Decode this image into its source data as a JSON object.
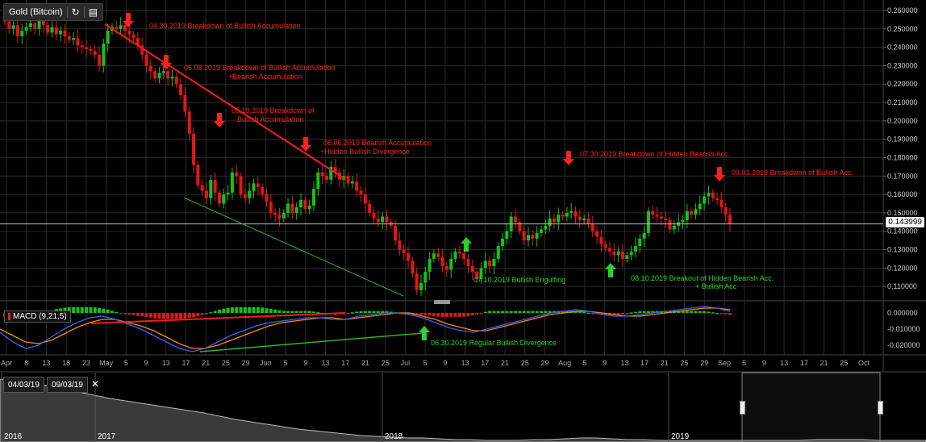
{
  "header": {
    "instrument": "Gold (Bitcoin)",
    "refresh_icon": "refresh-icon",
    "chart_icon": "bar-chart-icon"
  },
  "price_tag": "0.143999",
  "macd_label": "MACD (9,21,5)",
  "range": {
    "start": "04/03/19",
    "end": "09/03/19",
    "close_icon": "close-icon"
  },
  "navigator_years": [
    "2016",
    "2017",
    "2018",
    "2019"
  ],
  "colors": {
    "up": "#16c01a",
    "down": "#e0161b",
    "annotation_red": "#ff2020",
    "annotation_green": "#2cd22c",
    "macd_line": "#3366ff",
    "signal_line": "#ff8800",
    "background": "#000000",
    "grid": "#2b2b2b"
  },
  "chart_data": [
    {
      "type": "candlestick",
      "title": "Gold (Bitcoin)",
      "y_ticks": [
        0.26,
        0.25,
        0.24,
        0.23,
        0.22,
        0.21,
        0.2,
        0.19,
        0.18,
        0.17,
        0.16,
        0.15,
        0.14,
        0.13,
        0.12,
        0.11
      ],
      "y_tick_labels": [
        "0.260000",
        "0.250000",
        "0.240000",
        "0.230000",
        "0.220000",
        "0.210000",
        "0.200000",
        "0.190000",
        "0.180000",
        "0.170000",
        "0.160000",
        "0.150000",
        "0.140000",
        "0.130000",
        "0.120000",
        "0.110000"
      ],
      "ylim": [
        0.1035,
        0.2635
      ],
      "last_price": 0.143999,
      "x_ticks": [
        "Apr",
        "8",
        "13",
        "18",
        "23",
        "May",
        "5",
        "9",
        "13",
        "17",
        "21",
        "25",
        "29",
        "Jun",
        "5",
        "9",
        "13",
        "17",
        "21",
        "25",
        "Jul",
        "5",
        "9",
        "13",
        "17",
        "21",
        "25",
        "29",
        "Aug",
        "5",
        "9",
        "13",
        "17",
        "21",
        "25",
        "29",
        "Sep",
        "5",
        "9",
        "13",
        "17",
        "21",
        "25",
        "Oct"
      ],
      "closes": [
        0.254,
        0.25,
        0.252,
        0.246,
        0.249,
        0.251,
        0.253,
        0.25,
        0.255,
        0.252,
        0.248,
        0.251,
        0.247,
        0.249,
        0.246,
        0.244,
        0.245,
        0.241,
        0.24,
        0.239,
        0.238,
        0.236,
        0.23,
        0.242,
        0.249,
        0.251,
        0.25,
        0.252,
        0.249,
        0.247,
        0.245,
        0.241,
        0.236,
        0.23,
        0.227,
        0.223,
        0.226,
        0.227,
        0.223,
        0.224,
        0.22,
        0.214,
        0.205,
        0.193,
        0.176,
        0.165,
        0.162,
        0.158,
        0.168,
        0.161,
        0.155,
        0.16,
        0.161,
        0.172,
        0.17,
        0.16,
        0.158,
        0.162,
        0.166,
        0.164,
        0.16,
        0.156,
        0.15,
        0.149,
        0.147,
        0.15,
        0.155,
        0.15,
        0.153,
        0.157,
        0.152,
        0.154,
        0.163,
        0.172,
        0.17,
        0.168,
        0.175,
        0.172,
        0.168,
        0.17,
        0.166,
        0.167,
        0.162,
        0.16,
        0.155,
        0.15,
        0.147,
        0.145,
        0.148,
        0.145,
        0.143,
        0.135,
        0.13,
        0.128,
        0.124,
        0.117,
        0.108,
        0.112,
        0.118,
        0.125,
        0.128,
        0.126,
        0.121,
        0.119,
        0.125,
        0.129,
        0.128,
        0.125,
        0.121,
        0.118,
        0.114,
        0.12,
        0.124,
        0.121,
        0.125,
        0.132,
        0.136,
        0.14,
        0.148,
        0.145,
        0.14,
        0.135,
        0.138,
        0.136,
        0.139,
        0.141,
        0.143,
        0.147,
        0.145,
        0.149,
        0.148,
        0.15,
        0.151,
        0.148,
        0.146,
        0.147,
        0.144,
        0.14,
        0.137,
        0.133,
        0.131,
        0.129,
        0.127,
        0.129,
        0.125,
        0.127,
        0.129,
        0.132,
        0.136,
        0.139,
        0.151,
        0.149,
        0.148,
        0.147,
        0.146,
        0.141,
        0.143,
        0.145,
        0.146,
        0.151,
        0.149,
        0.152,
        0.155,
        0.159,
        0.161,
        0.158,
        0.157,
        0.153,
        0.149,
        0.144
      ],
      "ohlc_note": "",
      "annotations": [
        {
          "text": "04.30.2019 Breakdown of Bullish Accumulation",
          "color": "red"
        },
        {
          "text": "05.08.2019 Breakdown of Bullish Accumulation",
          "text2": "+Bearish Accumulation",
          "color": "red"
        },
        {
          "text": "05.19.2019 Breakdown of",
          "text2": "Bullish Accumulation",
          "color": "red"
        },
        {
          "text": "06.06.2019 Bearish Accumulation",
          "text2": "+Hidden Bullish Divergence",
          "color": "red"
        },
        {
          "text": "07.30.2019 Breakdown of Hidden Bearish Acc.",
          "color": "red"
        },
        {
          "text": "09.01.2019 Breakdwon of Bullish Acc.",
          "color": "red"
        },
        {
          "text": "07.10.2019 Bullish Engulfing",
          "color": "green"
        },
        {
          "text": "08.10.2019 Breakout of Hidden Bearish Acc.",
          "text2": "+ Bullish Acc",
          "color": "green"
        },
        {
          "text": "06.30.2019 Regular Bullish Divergence",
          "color": "green"
        }
      ]
    },
    {
      "type": "line",
      "title": "MACD (9,21,5)",
      "y_ticks": [
        0.0,
        -0.01,
        -0.02
      ],
      "y_tick_labels": [
        "0.000000",
        "-0.010000",
        "-0.020000"
      ],
      "ylim": [
        -0.025,
        0.005
      ],
      "series": [
        {
          "name": "MACD",
          "values": [
            -0.012,
            -0.018,
            -0.022,
            -0.02,
            -0.015,
            -0.01,
            -0.006,
            -0.003,
            -0.002,
            -0.004,
            -0.007,
            -0.01,
            -0.014,
            -0.018,
            -0.022,
            -0.024,
            -0.022,
            -0.018,
            -0.014,
            -0.011,
            -0.008,
            -0.006,
            -0.005,
            -0.004,
            -0.003,
            -0.003,
            -0.004,
            -0.004,
            -0.002,
            -0.001,
            0.0,
            0.0,
            -0.001,
            -0.003,
            -0.006,
            -0.009,
            -0.011,
            -0.012,
            -0.01,
            -0.008,
            -0.006,
            -0.004,
            -0.002,
            0.0,
            0.001,
            0.002,
            0.001,
            -0.001,
            -0.002,
            -0.002,
            -0.001,
            0.0,
            0.001,
            0.002,
            0.003,
            0.004,
            0.003,
            0.001
          ]
        },
        {
          "name": "Signal",
          "values": [
            -0.01,
            -0.014,
            -0.018,
            -0.019,
            -0.017,
            -0.013,
            -0.009,
            -0.006,
            -0.004,
            -0.004,
            -0.006,
            -0.008,
            -0.011,
            -0.015,
            -0.019,
            -0.022,
            -0.022,
            -0.02,
            -0.017,
            -0.014,
            -0.011,
            -0.008,
            -0.006,
            -0.005,
            -0.004,
            -0.003,
            -0.003,
            -0.004,
            -0.003,
            -0.002,
            -0.001,
            0.0,
            0.0,
            -0.002,
            -0.004,
            -0.007,
            -0.009,
            -0.011,
            -0.011,
            -0.009,
            -0.007,
            -0.005,
            -0.003,
            -0.001,
            0.0,
            0.001,
            0.001,
            0.0,
            -0.001,
            -0.002,
            -0.002,
            -0.001,
            0.0,
            0.001,
            0.002,
            0.003,
            0.003,
            0.002
          ]
        }
      ]
    }
  ]
}
